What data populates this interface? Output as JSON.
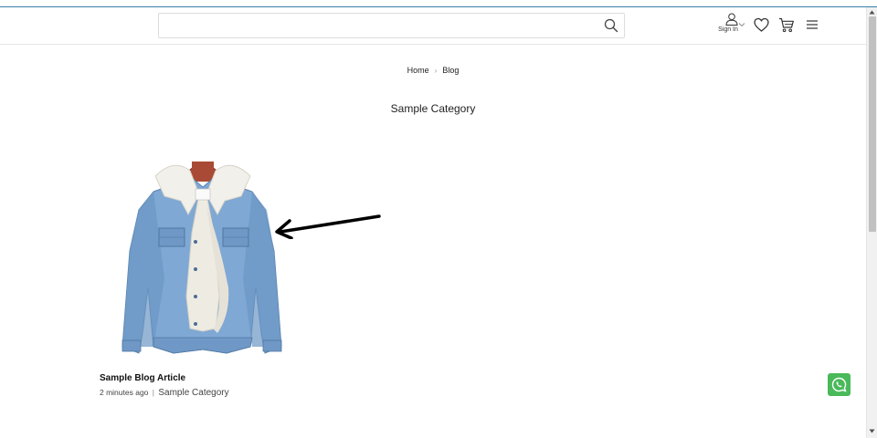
{
  "header": {
    "search": {
      "value": "",
      "placeholder": ""
    },
    "account": {
      "label": "Sign In"
    }
  },
  "breadcrumb": {
    "items": [
      "Home",
      "Blog"
    ],
    "separator": "›"
  },
  "page": {
    "title": "Sample Category"
  },
  "article": {
    "title": "Sample Blog Article",
    "time_ago": "2 minutes ago",
    "divider": "|",
    "category": "Sample Category"
  },
  "colors": {
    "whatsapp": "#4ab95a",
    "accent_line": "#3a7fa6"
  },
  "icons": [
    "search-icon",
    "user-icon",
    "chevron-down-icon",
    "heart-icon",
    "cart-icon",
    "hamburger-menu-icon",
    "whatsapp-icon",
    "arrow-icon"
  ]
}
